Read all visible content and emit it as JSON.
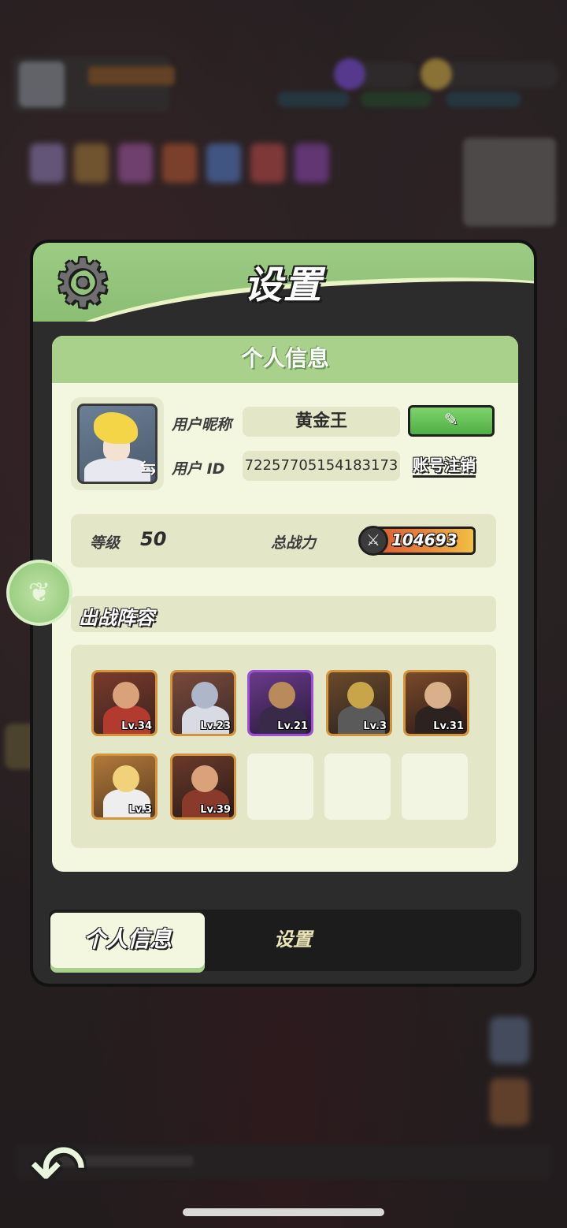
{
  "panel": {
    "title": "设置",
    "card_title": "个人信息"
  },
  "profile": {
    "nickname_label": "用户昵称",
    "nickname": "黄金王",
    "edit_icon": "✎",
    "uid_label": "用户 ID",
    "uid": "72257705154183173",
    "deregister_label": "账号注销",
    "swap_icon": "⇆"
  },
  "stats": {
    "level_label": "等级",
    "level": "50",
    "power_label": "总战力",
    "power": "104693"
  },
  "lineup": {
    "title": "出战阵容",
    "heroes": [
      {
        "level": "Lv.34",
        "color": "#b23a2e"
      },
      {
        "level": "Lv.23",
        "color": "#d9dbe4"
      },
      {
        "level": "Lv.21",
        "color": "#3a2a4a"
      },
      {
        "level": "Lv.3",
        "color": "#5a5a5a"
      },
      {
        "level": "Lv.31",
        "color": "#2c2320"
      },
      {
        "level": "Lv.3",
        "color": "#eeeeee"
      },
      {
        "level": "Lv.39",
        "color": "#8a3a2a"
      }
    ]
  },
  "tabs": {
    "profile": "个人信息",
    "settings": "设置"
  },
  "icons": {
    "gear": "gear-icon",
    "back": "back-arrow-icon",
    "side": "leaf-icon"
  }
}
